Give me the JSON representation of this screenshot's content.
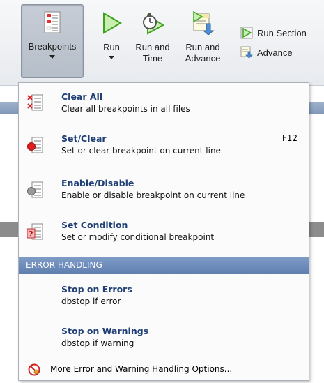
{
  "toolbar": {
    "breakpoints_label": "Breakpoints",
    "run_label": "Run",
    "run_and_time_label": "Run and\nTime",
    "run_and_advance_label": "Run and\nAdvance",
    "run_section_label": "Run Section",
    "advance_label": "Advance"
  },
  "menu": {
    "items": [
      {
        "title": "Clear All",
        "desc": "Clear all breakpoints in all files",
        "shortcut": "",
        "icon": "clear-breakpoints-icon"
      },
      {
        "title": "Set/Clear",
        "desc": "Set or clear breakpoint on current line",
        "shortcut": "F12",
        "icon": "breakpoint-icon"
      },
      {
        "title": "Enable/Disable",
        "desc": "Enable or disable breakpoint on current line",
        "shortcut": "",
        "icon": "disabled-breakpoint-icon"
      },
      {
        "title": "Set Condition",
        "desc": "Set or modify conditional breakpoint",
        "shortcut": "",
        "icon": "conditional-breakpoint-icon"
      }
    ],
    "section_header": "ERROR HANDLING",
    "error_items": [
      {
        "title": "Stop on Errors",
        "desc": "dbstop if error"
      },
      {
        "title": "Stop on Warnings",
        "desc": "dbstop if warning"
      }
    ],
    "footer_label": "More Error and Warning Handling Options...",
    "footer_icon": "error-options-icon"
  },
  "colors": {
    "title_text": "#1f3f77",
    "section_header": "#6a88b8",
    "breakpoint_red": "#e02020"
  }
}
